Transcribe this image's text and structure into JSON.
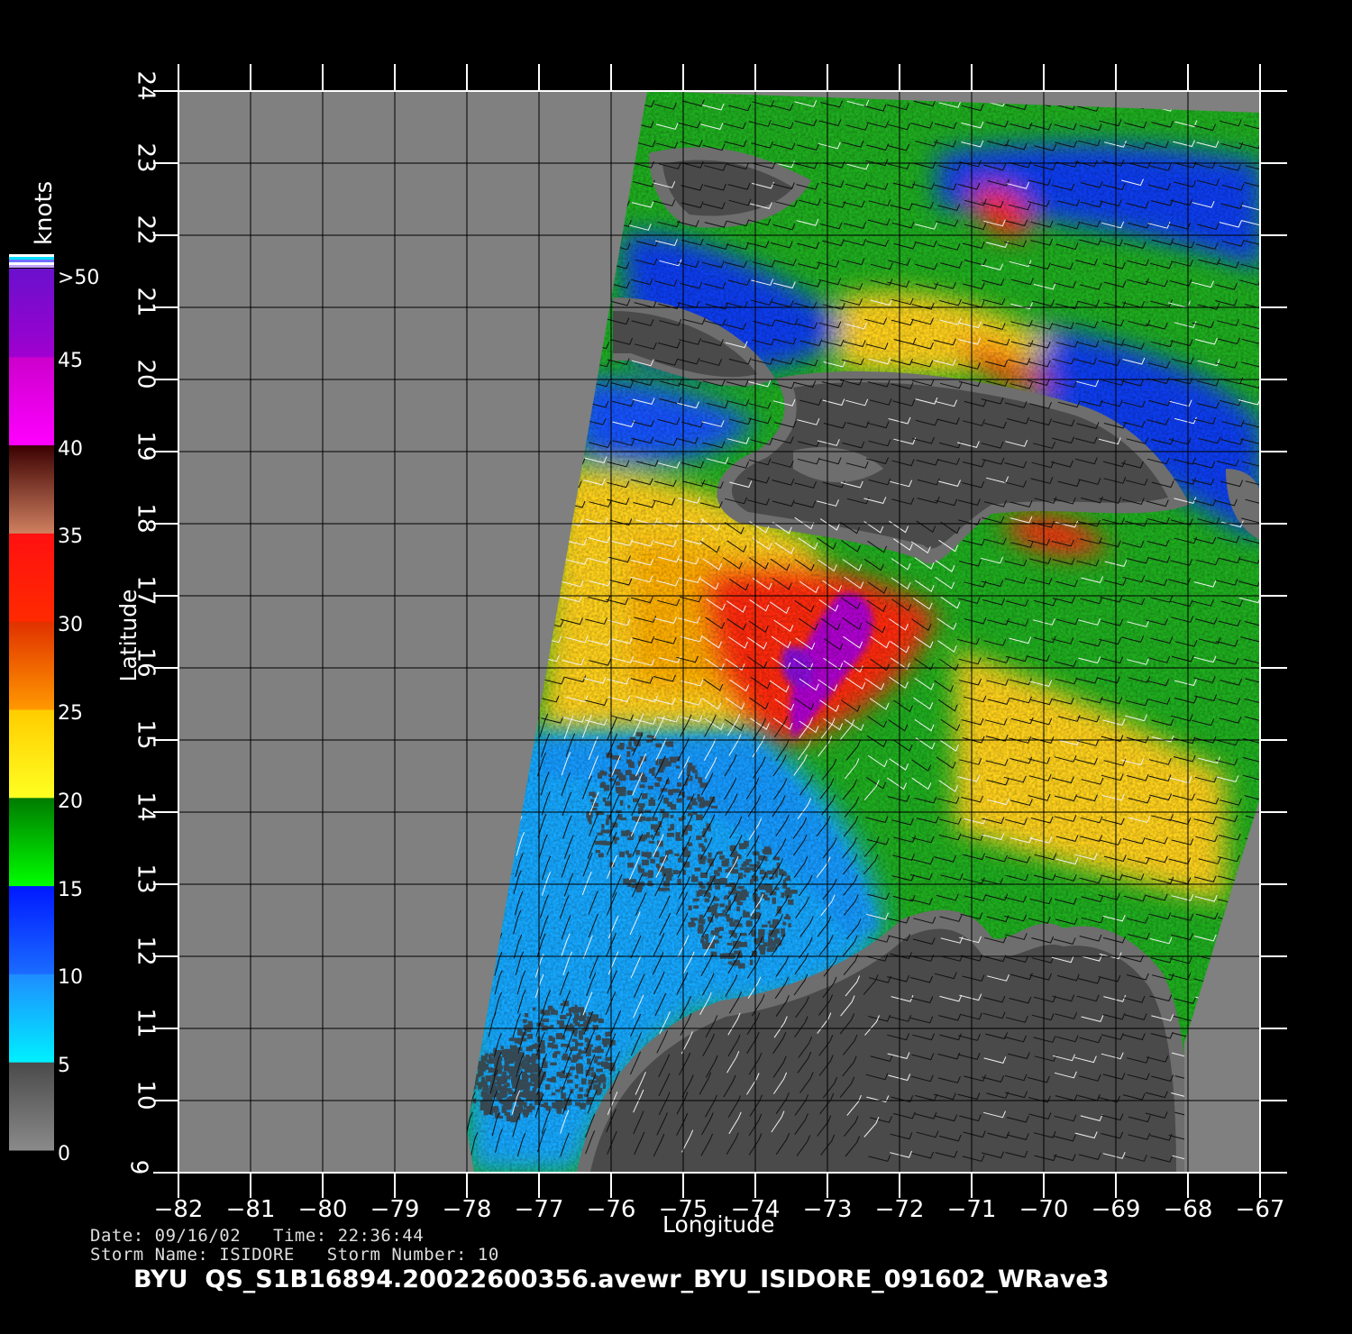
{
  "header": {
    "date_label": "Date:",
    "date": "09/16/02",
    "time_label": "Time:",
    "time": "22:36:44",
    "storm_name_label": "Storm Name:",
    "storm_name": "ISIDORE",
    "storm_number_label": "Storm Number:",
    "storm_number": "10"
  },
  "file_title": "BYU  QS_S1B16894.20022600356.avewr_BYU_ISIDORE_091602_WRave3",
  "map": {
    "xlabel": "Longitude",
    "ylabel": "Latitude",
    "lon_range": [
      -82,
      -67
    ],
    "lat_range": [
      9,
      24
    ],
    "lon_ticks": [
      "−82",
      "−81",
      "−80",
      "−79",
      "−78",
      "−77",
      "−76",
      "−75",
      "−74",
      "−73",
      "−72",
      "−71",
      "−70",
      "−69",
      "−68",
      "−67"
    ],
    "lat_ticks": [
      "9",
      "10",
      "11",
      "12",
      "13",
      "14",
      "15",
      "16",
      "17",
      "18",
      "19",
      "20",
      "21",
      "22",
      "23",
      "24"
    ],
    "colors": {
      "no_data": "#808080",
      "land": "#4a4a4a",
      "land_edge": "#6e6e6e",
      "grid": "#000000",
      "frame": "#ffffff"
    }
  },
  "colorbar": {
    "units": "knots",
    "labels": [
      ">50",
      "45",
      "40",
      "35",
      "30",
      "25",
      "20",
      "15",
      "10",
      "5",
      "0"
    ],
    "bands": [
      {
        "from": 0,
        "to": 5,
        "top": "#4a4a4a",
        "bottom": "#8a8a8a"
      },
      {
        "from": 5,
        "to": 10,
        "top": "#1e8cff",
        "bottom": "#00f0ff"
      },
      {
        "from": 10,
        "to": 15,
        "top": "#0018ff",
        "bottom": "#1a6cff"
      },
      {
        "from": 15,
        "to": 20,
        "top": "#007a00",
        "bottom": "#00ff00"
      },
      {
        "from": 20,
        "to": 25,
        "top": "#ffcc00",
        "bottom": "#ffff22"
      },
      {
        "from": 25,
        "to": 30,
        "top": "#e03000",
        "bottom": "#ff9900"
      },
      {
        "from": 30,
        "to": 35,
        "top": "#ff1010",
        "bottom": "#ff2a00"
      },
      {
        "from": 35,
        "to": 40,
        "top": "#3a0000",
        "bottom": "#d08060"
      },
      {
        "from": 40,
        "to": 45,
        "top": "#cc00cc",
        "bottom": "#ff00ff"
      },
      {
        "from": 45,
        "to": 50,
        "top": "#6a10cc",
        "bottom": "#a000d0"
      }
    ]
  }
}
